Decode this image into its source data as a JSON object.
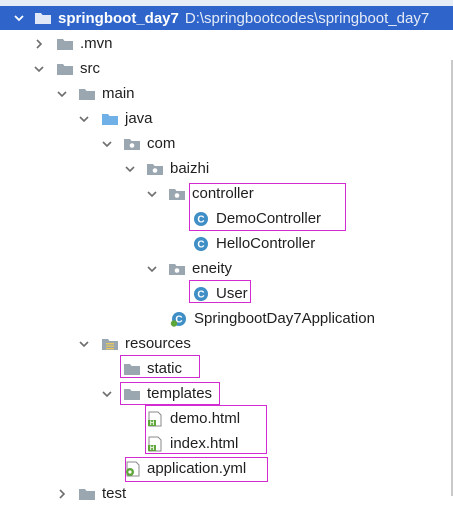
{
  "project": {
    "name": "springboot_day7",
    "path": "D:\\springbootcodes\\springboot_day7"
  },
  "tree": {
    "mvn": ".mvn",
    "src": "src",
    "main": "main",
    "java": "java",
    "com": "com",
    "baizhi": "baizhi",
    "controller": "controller",
    "demo_controller": "DemoController",
    "hello_controller": "HelloController",
    "eneity": "eneity",
    "user": "User",
    "app": "SpringbootDay7Application",
    "resources": "resources",
    "static": "static",
    "templates": "templates",
    "demo_html": "demo.html",
    "index_html": "index.html",
    "application_yml": "application.yml",
    "test": "test"
  },
  "colors": {
    "selection": "#2f65ca",
    "highlight_box": "#d12bd1",
    "folder": "#9aa7b0",
    "source_folder": "#6fb0e6",
    "class_icon": "#3f8ec6",
    "html_badge": "#5fa63a"
  }
}
